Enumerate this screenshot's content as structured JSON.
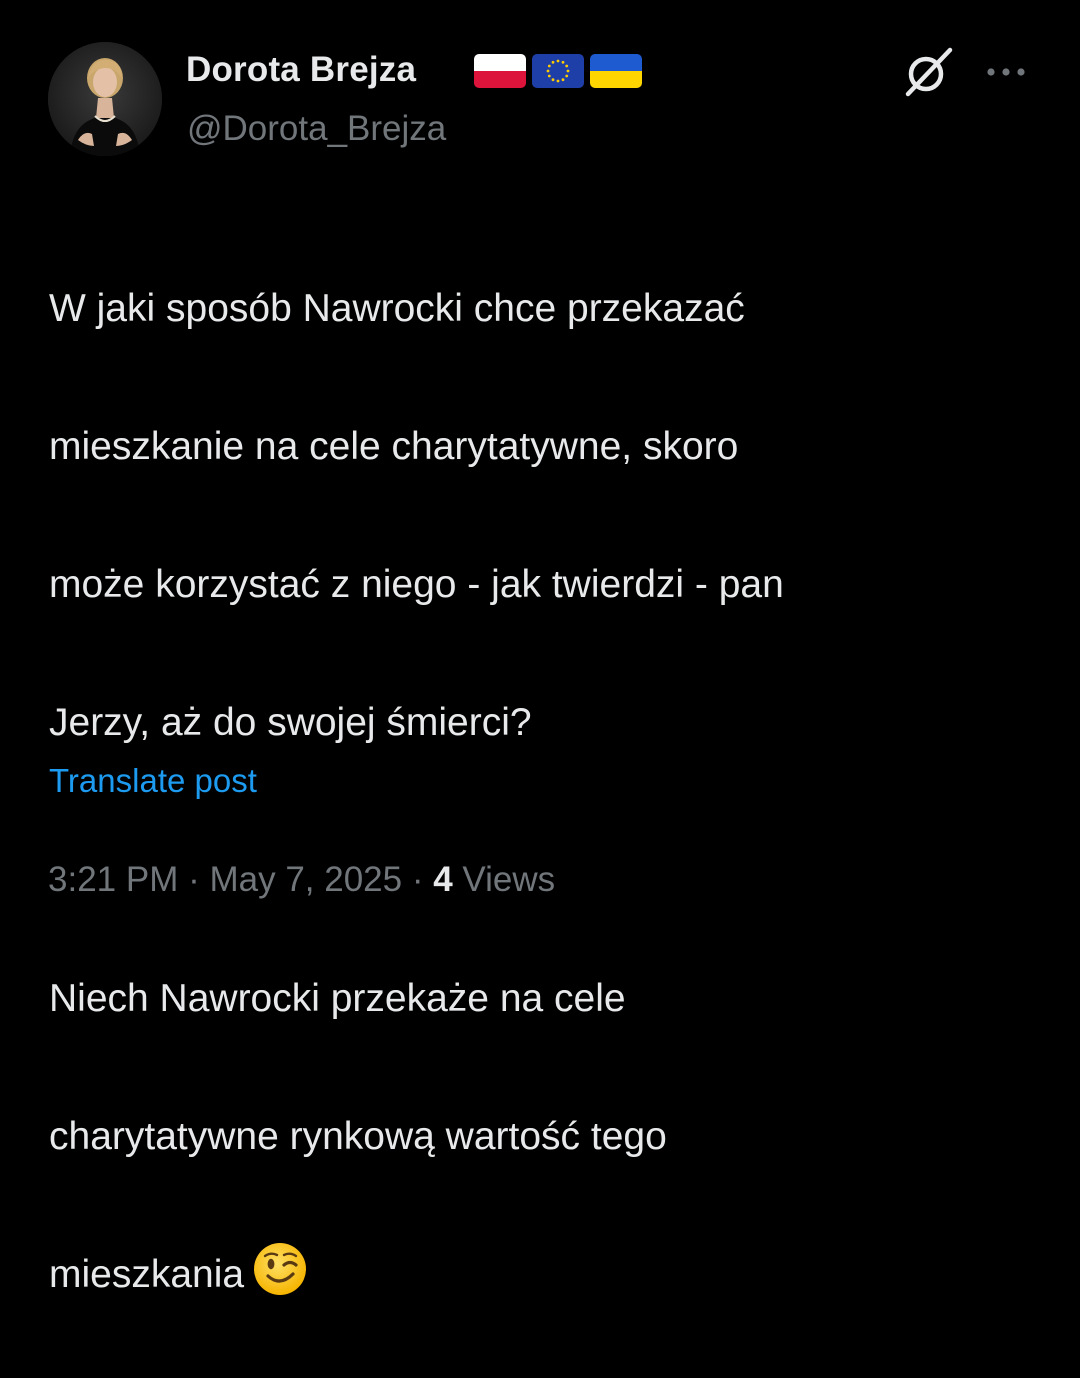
{
  "author": {
    "display_name": "Dorota Brejza",
    "handle": "@Dorota_Brejza",
    "flags": [
      "poland-flag",
      "eu-flag",
      "ukraine-flag"
    ]
  },
  "actions": {
    "grok_icon": "grok-icon",
    "more_icon": "more-icon"
  },
  "post": {
    "lines": [
      "W jaki sposób Nawrocki chce przekazać",
      "mieszkanie na cele charytatywne, skoro",
      "może korzystać z niego - jak twierdzi - pan",
      "Jerzy, aż do swojej śmierci?",
      "",
      "Niech Nawrocki przekaże na cele",
      "charytatywne rynkową wartość tego",
      "mieszkania"
    ],
    "emoji": "winking-face-emoji",
    "translate_label": "Translate post"
  },
  "meta": {
    "time": "3:21 PM",
    "separator": " · ",
    "date": "May 7, 2025",
    "views_count": "4",
    "views_label": " Views"
  },
  "colors": {
    "background": "#000000",
    "text_primary": "#e7e9ea",
    "text_secondary": "#71767b",
    "link": "#1d9bf0"
  }
}
